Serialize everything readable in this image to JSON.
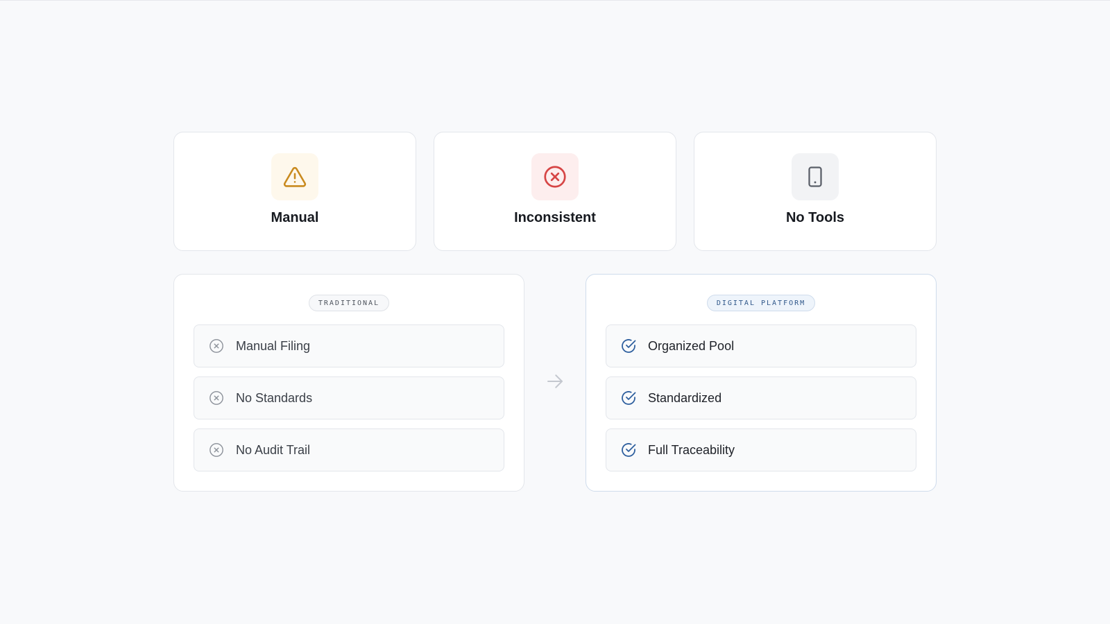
{
  "cards": [
    {
      "title": "Manual",
      "icon": "warning-triangle-icon",
      "tone": "#c98a1e"
    },
    {
      "title": "Inconsistent",
      "icon": "x-circle-icon",
      "tone": "#d64545"
    },
    {
      "title": "No Tools",
      "icon": "tablet-icon",
      "tone": "#5a5f68"
    }
  ],
  "comparison": {
    "traditional": {
      "badge": "TRADITIONAL",
      "icon": "x-circle-icon",
      "items": [
        "Manual Filing",
        "No Standards",
        "No Audit Trail"
      ]
    },
    "arrow_icon": "arrow-right-icon",
    "digital": {
      "badge": "DIGITAL PLATFORM",
      "icon": "check-circle-icon",
      "accent": "#2e5f9e",
      "items": [
        "Organized Pool",
        "Standardized",
        "Full Traceability"
      ]
    }
  }
}
